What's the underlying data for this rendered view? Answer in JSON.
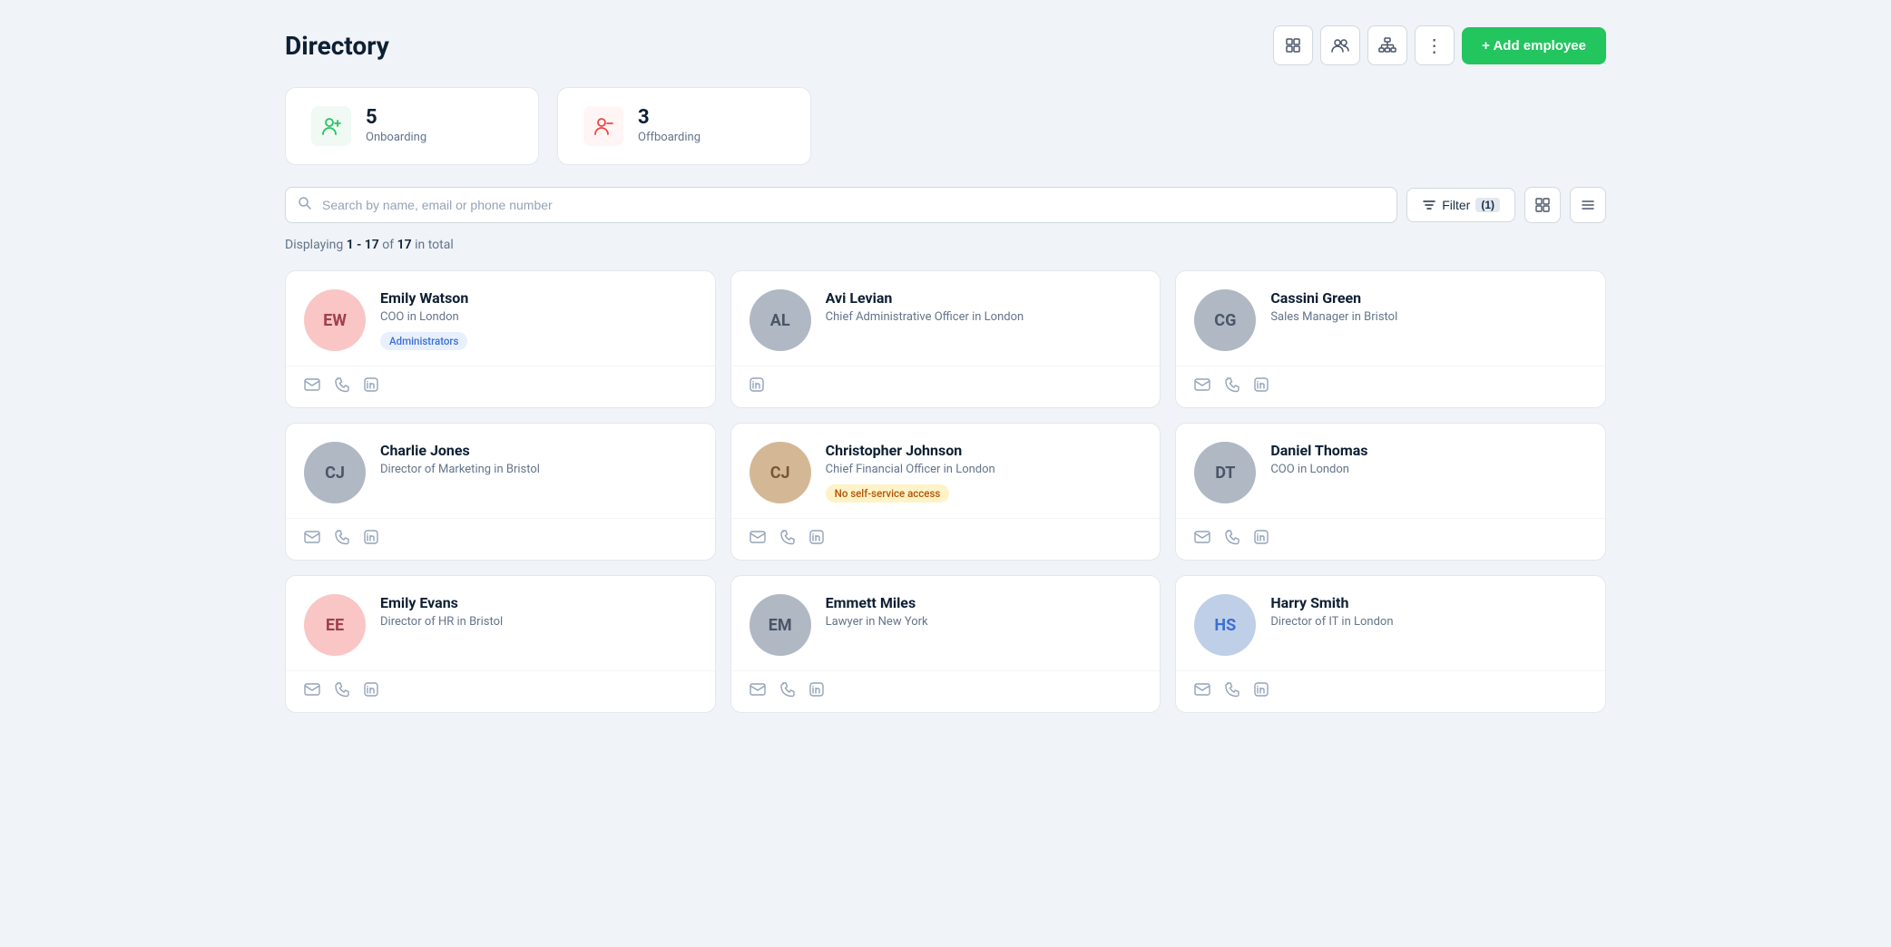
{
  "header": {
    "title": "Directory",
    "add_employee_label": "+ Add employee"
  },
  "stats": [
    {
      "id": "onboarding",
      "count": "5",
      "label": "Onboarding",
      "icon_type": "onboarding"
    },
    {
      "id": "offboarding",
      "count": "3",
      "label": "Offboarding",
      "icon_type": "offboarding"
    }
  ],
  "search": {
    "placeholder": "Search by name, email or phone number"
  },
  "filter": {
    "label": "Filter",
    "count": "1"
  },
  "results": {
    "prefix": "Displaying ",
    "range": "1 - 17",
    "of_text": " of ",
    "total": "17",
    "suffix": " in total"
  },
  "employees": [
    {
      "name": "Emily Watson",
      "role": "COO in London",
      "badge": "Administrators",
      "badge_type": "admin",
      "has_email": true,
      "has_phone": true,
      "has_linkedin": true,
      "avatar_color": "pink",
      "initials": "EW"
    },
    {
      "name": "Avi Levian",
      "role": "Chief Administrative Officer in London",
      "badge": "",
      "badge_type": "",
      "has_email": false,
      "has_phone": false,
      "has_linkedin": true,
      "avatar_color": "gray",
      "initials": "AL"
    },
    {
      "name": "Cassini Green",
      "role": "Sales Manager in Bristol",
      "badge": "",
      "badge_type": "",
      "has_email": true,
      "has_phone": true,
      "has_linkedin": true,
      "avatar_color": "gray",
      "initials": "CG"
    },
    {
      "name": "Charlie Jones",
      "role": "Director of Marketing in Bristol",
      "badge": "",
      "badge_type": "",
      "has_email": true,
      "has_phone": true,
      "has_linkedin": true,
      "avatar_color": "gray",
      "initials": "CJ"
    },
    {
      "name": "Christopher Johnson",
      "role": "Chief Financial Officer in London",
      "badge": "No self-service access",
      "badge_type": "no-access",
      "has_email": true,
      "has_phone": true,
      "has_linkedin": true,
      "avatar_color": "warm",
      "initials": "CJ"
    },
    {
      "name": "Daniel Thomas",
      "role": "COO in London",
      "badge": "",
      "badge_type": "",
      "has_email": true,
      "has_phone": true,
      "has_linkedin": true,
      "avatar_color": "gray",
      "initials": "DT"
    },
    {
      "name": "Emily Evans",
      "role": "Director of HR in Bristol",
      "badge": "",
      "badge_type": "",
      "has_email": true,
      "has_phone": true,
      "has_linkedin": true,
      "avatar_color": "pink",
      "initials": "EE"
    },
    {
      "name": "Emmett Miles",
      "role": "Lawyer in New York",
      "badge": "",
      "badge_type": "",
      "has_email": true,
      "has_phone": true,
      "has_linkedin": true,
      "avatar_color": "gray",
      "initials": "EM"
    },
    {
      "name": "Harry Smith",
      "role": "Director of IT in London",
      "badge": "",
      "badge_type": "",
      "has_email": true,
      "has_phone": true,
      "has_linkedin": true,
      "avatar_color": "blue",
      "initials": "HS"
    }
  ]
}
